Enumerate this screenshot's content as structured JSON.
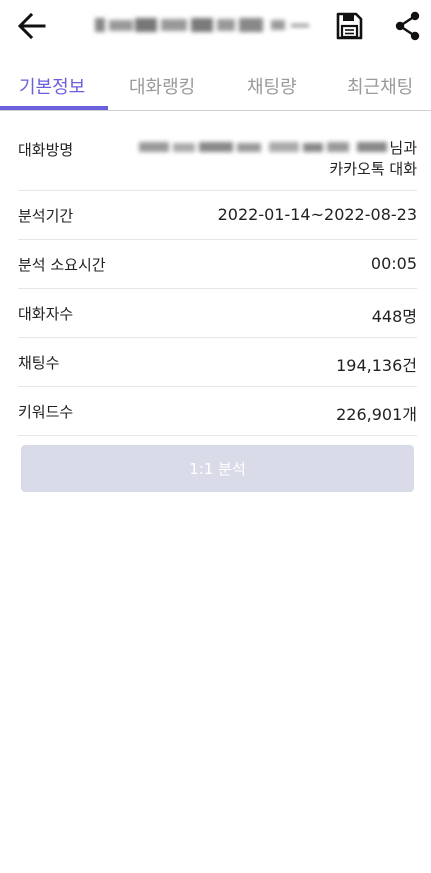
{
  "header": {
    "back_icon": "arrow-left-icon",
    "save_icon": "save-icon",
    "share_icon": "share-icon"
  },
  "tabs": [
    {
      "label": "기본정보",
      "active": true
    },
    {
      "label": "대화랭킹",
      "active": false
    },
    {
      "label": "채팅량",
      "active": false
    },
    {
      "label": "최근채팅",
      "active": false
    }
  ],
  "info": {
    "room_name": {
      "label": "대화방명",
      "suffix": "님과",
      "line2": "카카오톡 대화"
    },
    "period": {
      "label": "분석기간",
      "value": "2022-01-14~2022-08-23"
    },
    "duration": {
      "label": "분석 소요시간",
      "value": "00:05"
    },
    "participants": {
      "label": "대화자수",
      "value": "448명"
    },
    "chats": {
      "label": "채팅수",
      "value": "194,136건"
    },
    "keywords": {
      "label": "키워드수",
      "value": "226,901개"
    }
  },
  "actions": {
    "one_to_one_label": "1:1 분석"
  },
  "colors": {
    "accent": "#6a5fdc",
    "tab_inactive": "#9a9a9a",
    "disabled_button": "#d9dce8"
  }
}
